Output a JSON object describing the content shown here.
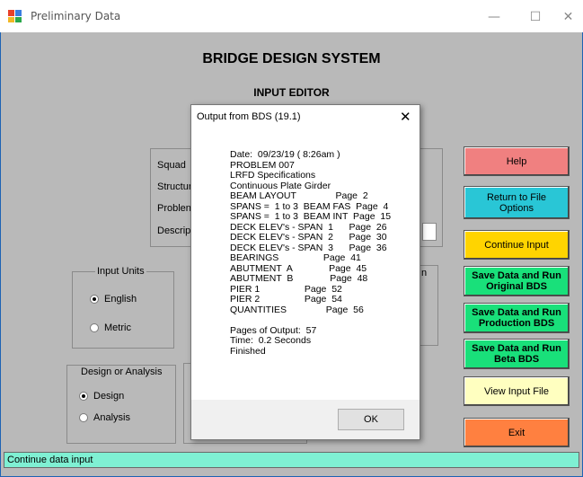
{
  "window": {
    "title": "Preliminary Data",
    "minimize_glyph": "—",
    "maximize_glyph": "☐",
    "close_glyph": "✕"
  },
  "headings": {
    "main": "BRIDGE DESIGN SYSTEM",
    "sub": "INPUT EDITOR"
  },
  "form_labels": {
    "squad": "Squad",
    "structure": "Structur",
    "problem": "Problen",
    "description": "Descrip"
  },
  "input_units": {
    "label": "Input Units",
    "options": [
      "English",
      "Metric"
    ],
    "selected": "English"
  },
  "design_or_analysis": {
    "label": "Design or Analysis",
    "options": [
      "Design",
      "Analysis"
    ],
    "selected": "Design"
  },
  "hidden_group_label_fragment": "n",
  "buttons": {
    "help": "Help",
    "return_to_file": "Return to File Options",
    "continue_input": "Continue Input",
    "save_original": "Save Data and Run Original BDS",
    "save_production": "Save Data and Run Production BDS",
    "save_beta": "Save Data and Run Beta BDS",
    "view_input": "View Input File",
    "exit": "Exit"
  },
  "button_colors": {
    "help": "#f08080",
    "return_to_file": "#29c6d6",
    "continue_input": "#ffd400",
    "save_green": "#19e07a",
    "view_input": "#ffffc0",
    "exit": "#ff8040"
  },
  "status": {
    "text": "Continue data input"
  },
  "dialog": {
    "title": "Output from BDS (19.1)",
    "close_glyph": "✕",
    "lines": [
      "Date:  09/23/19 ( 8:26am )",
      "PROBLEM 007",
      "LRFD Specifications",
      "Continuous Plate Girder",
      "BEAM LAYOUT               Page  2",
      "SPANS =  1 to 3  BEAM FAS  Page  4",
      "SPANS =  1 to 3  BEAM INT  Page  15",
      "DECK ELEV's - SPAN  1      Page  26",
      "DECK ELEV's - SPAN  2      Page  30",
      "DECK ELEV's - SPAN  3      Page  36",
      "BEARINGS                 Page  41",
      "ABUTMENT  A              Page  45",
      "ABUTMENT  B              Page  48",
      "PIER 1                 Page  52",
      "PIER 2                 Page  54",
      "QUANTITIES               Page  56",
      "",
      "Pages of Output:  57",
      "Time:  0.2 Seconds",
      "Finished"
    ],
    "ok_label": "OK"
  }
}
